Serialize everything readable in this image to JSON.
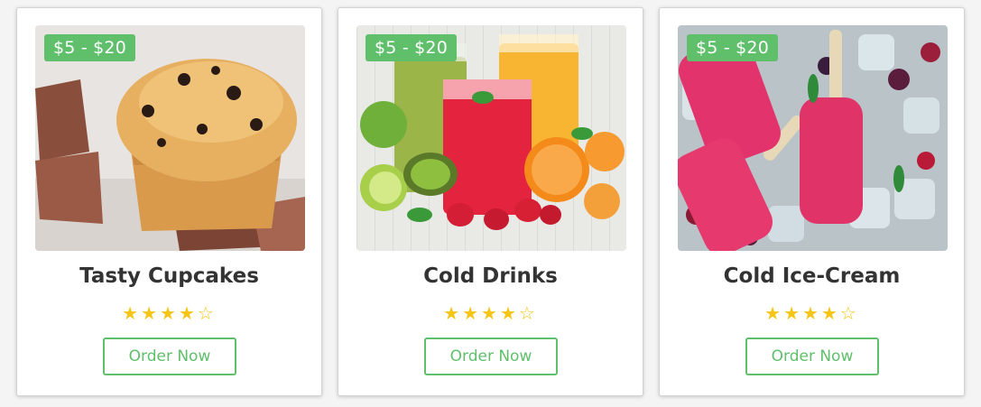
{
  "cards": [
    {
      "title": "Tasty Cupcakes",
      "price": "$5 - $20",
      "rating": 4,
      "max_rating": 5,
      "button_label": "Order Now",
      "image": "cupcake-with-chocolate"
    },
    {
      "title": "Cold Drinks",
      "price": "$5 - $20",
      "rating": 4,
      "max_rating": 5,
      "button_label": "Order Now",
      "image": "fruit-juices"
    },
    {
      "title": "Cold Ice-Cream",
      "price": "$5 - $20",
      "rating": 4,
      "max_rating": 5,
      "button_label": "Order Now",
      "image": "raspberry-popsicles-on-ice"
    }
  ],
  "colors": {
    "accent": "#5fbf6b",
    "star": "#f5c518",
    "title": "#333333"
  }
}
